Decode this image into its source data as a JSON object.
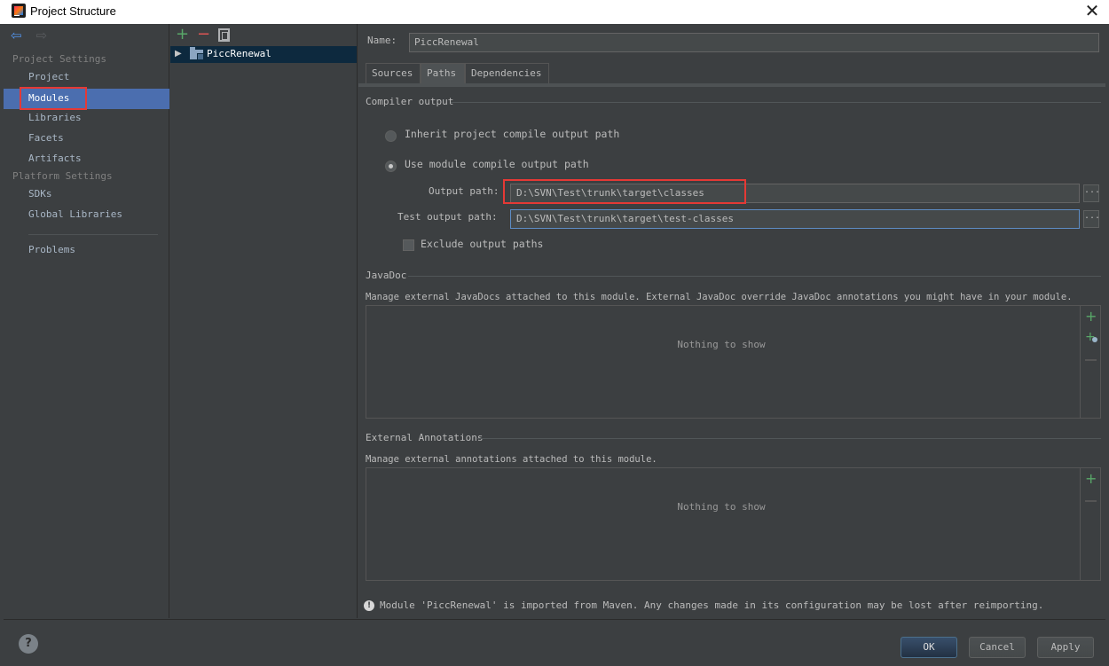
{
  "window": {
    "title": "Project Structure",
    "close_glyph": "✕"
  },
  "nav": {
    "back_icon": "arrow-left-icon",
    "forward_icon": "arrow-right-icon",
    "sections": [
      {
        "heading": "Project Settings",
        "items": [
          "Project",
          "Modules",
          "Libraries",
          "Facets",
          "Artifacts"
        ]
      },
      {
        "heading": "Platform Settings",
        "items": [
          "SDKs",
          "Global Libraries"
        ]
      }
    ],
    "problems": "Problems",
    "selected": "Modules"
  },
  "modules": {
    "toolbar": {
      "add": "+",
      "remove": "−"
    },
    "items": [
      "PiccRenewal"
    ],
    "expander": "▶"
  },
  "module": {
    "name_label": "Name:",
    "name_value": "PiccRenewal",
    "tabs": [
      "Sources",
      "Paths",
      "Dependencies"
    ],
    "active_tab": "Paths"
  },
  "compiler": {
    "title": "Compiler output",
    "inherit_label": "Inherit project compile output path",
    "use_module_label": "Use module compile output path",
    "output_label": "Output path:",
    "output_value": "D:\\SVN\\Test\\trunk\\target\\classes",
    "test_output_label": "Test output path:",
    "test_output_value": "D:\\SVN\\Test\\trunk\\target\\test-classes",
    "exclude_label": "Exclude output paths",
    "browse": "..."
  },
  "javadoc": {
    "title": "JavaDoc",
    "desc": "Manage external JavaDocs attached to this module. External JavaDoc override JavaDoc annotations you might have in your module.",
    "empty": "Nothing to show"
  },
  "annotations": {
    "title": "External Annotations",
    "desc": "Manage external annotations attached to this module.",
    "empty": "Nothing to show"
  },
  "warning": {
    "icon": "!",
    "text": "Module 'PiccRenewal' is imported from Maven. Any changes made in its configuration may be lost after reimporting."
  },
  "buttons": {
    "help": "?",
    "ok": "OK",
    "cancel": "Cancel",
    "apply": "Apply"
  }
}
